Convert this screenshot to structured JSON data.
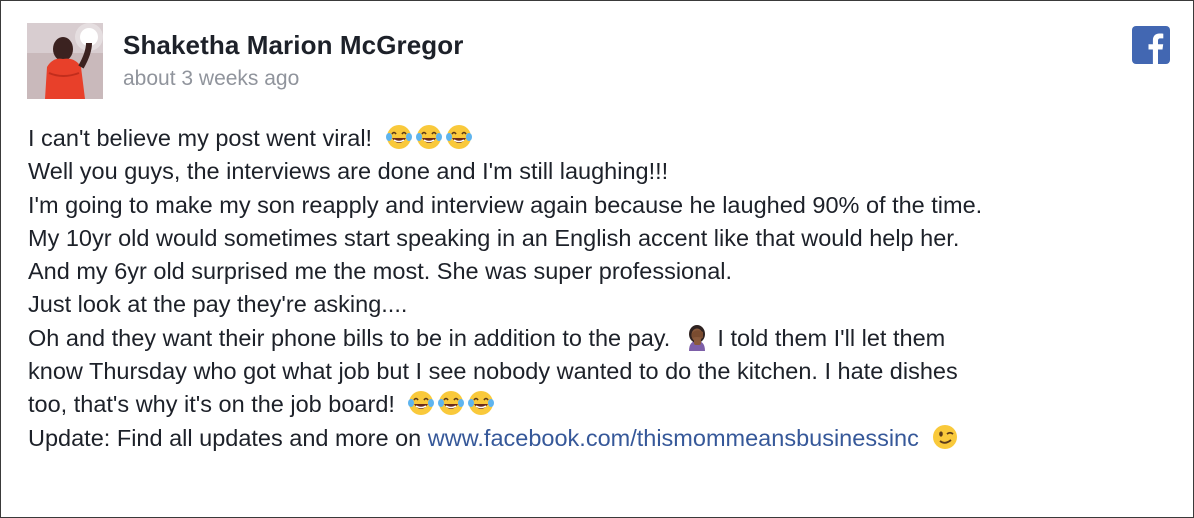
{
  "post": {
    "author_name": "Shaketha Marion McGregor",
    "timestamp": "about 3 weeks ago",
    "platform_icon": "facebook-icon",
    "lines": [
      "I can't believe my post went viral!",
      "Well you guys, the interviews are done and I'm still laughing!!!",
      "I'm going to make my son reapply and interview again because he laughed 90% of the time.",
      "My 10yr old would sometimes start speaking in an English accent like that would help her.",
      "And my 6yr old surprised me the most. She was super professional.",
      "Just look at the pay they're asking....",
      "Oh and they want their phone bills to be in addition to the pay.",
      "I told them I'll let them",
      "know Thursday who got what job but I see nobody wanted to do the kitchen. I hate dishes",
      "too, that's why it's on the job board!",
      "Update: Find all updates and more on "
    ],
    "link_text": "www.facebook.com/thismommeansbusinessinc",
    "emoji": {
      "laughing": "tears-of-joy-emoji",
      "facepalm": "woman-facepalming-emoji",
      "wink": "winking-face-emoji"
    }
  },
  "colors": {
    "name": "#1d2129",
    "timestamp": "#90949c",
    "link": "#365899",
    "facebook_blue": "#4267b2",
    "border": "#3a3a3a"
  }
}
